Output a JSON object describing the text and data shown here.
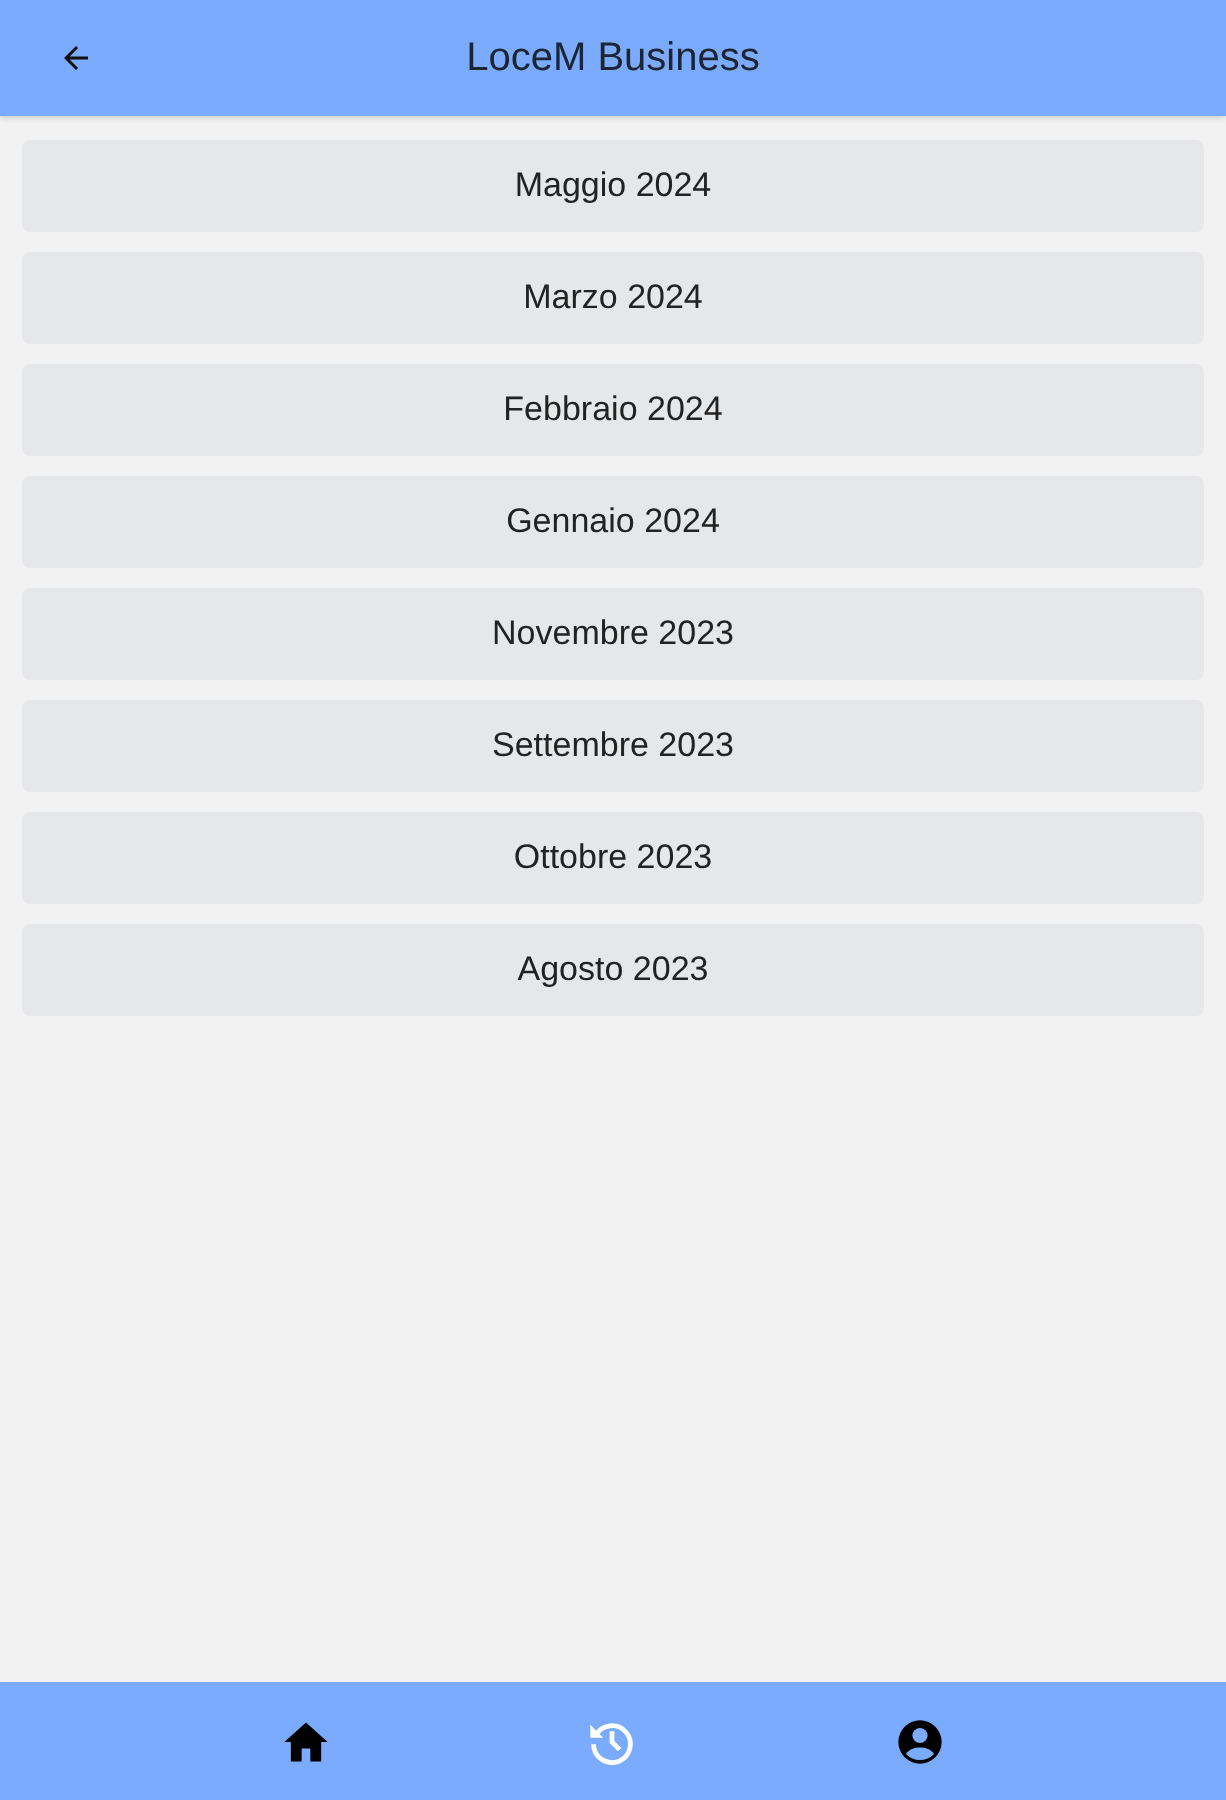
{
  "app_bar": {
    "title": "LoceM Business"
  },
  "months": [
    "Maggio 2024",
    "Marzo 2024",
    "Febbraio 2024",
    "Gennaio 2024",
    "Novembre 2023",
    "Settembre 2023",
    "Ottobre 2023",
    "Agosto 2023"
  ],
  "bottom_nav": [
    {
      "kind": "home",
      "selected": false
    },
    {
      "kind": "history",
      "selected": true
    },
    {
      "kind": "account",
      "selected": false
    }
  ]
}
